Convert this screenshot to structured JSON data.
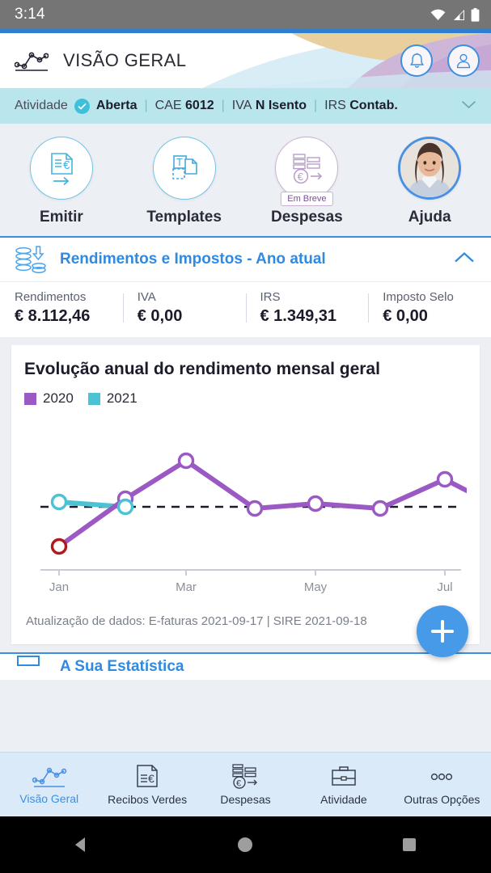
{
  "statusbar": {
    "time": "3:14",
    "icons": [
      "wifi-icon",
      "signal-icon",
      "battery-icon"
    ]
  },
  "header": {
    "title": "VISÃO GERAL",
    "logo_icon": "line-chart-logo-icon",
    "notifications_icon": "bell-icon",
    "profile_icon": "user-icon",
    "accent_color": "#2f7fd0"
  },
  "activity_bar": {
    "label": "Atividade",
    "status": "Aberta",
    "check_icon": "check-circle-icon",
    "fields": [
      {
        "key": "CAE",
        "value": "6012"
      },
      {
        "key": "IVA",
        "value": "N Isento"
      },
      {
        "key": "IRS",
        "value": "Contab."
      }
    ],
    "expand_icon": "chevron-down-icon",
    "background_color": "#b8e6ec"
  },
  "quick_actions": [
    {
      "label": "Emitir",
      "icon": "invoice-euro-arrow-icon",
      "badge": "",
      "disabled": false
    },
    {
      "label": "Templates",
      "icon": "template-document-icon",
      "badge": "",
      "disabled": false
    },
    {
      "label": "Despesas",
      "icon": "expenses-euro-arrow-icon",
      "badge": "Em Breve",
      "disabled": true
    },
    {
      "label": "Ajuda",
      "icon": "support-agent-photo",
      "badge": "",
      "disabled": false
    }
  ],
  "income_section": {
    "icon": "coins-download-icon",
    "title": "Rendimentos e Impostos - Ano atual",
    "collapse_icon": "chevron-up-icon",
    "title_color": "#2f8ae0",
    "stats": [
      {
        "key": "Rendimentos",
        "value": "€ 8.112,46"
      },
      {
        "key": "IVA",
        "value": "€ 0,00"
      },
      {
        "key": "IRS",
        "value": "€ 1.349,31"
      },
      {
        "key": "Imposto Selo",
        "value": "€ 0,00"
      }
    ]
  },
  "chart_card": {
    "footer": "Atualização de dados: E-faturas 2021-09-17 | SIRE 2021-09-18",
    "fab_icon": "add-plus-icon",
    "fab_color": "#479ae8"
  },
  "chart_data": {
    "type": "line",
    "title": "Evolução anual do rendimento mensal geral",
    "xlabel": "",
    "ylabel": "",
    "grid": false,
    "legend_position": "top-left",
    "x": [
      "Jan",
      "Feb",
      "Mar",
      "Apr",
      "May",
      "Jun",
      "Jul",
      "Aug"
    ],
    "tick_labels": [
      "Jan",
      "Mar",
      "May",
      "Jul"
    ],
    "ylim": [
      0,
      100
    ],
    "average_line": {
      "value": 55,
      "style": "dashed",
      "color": "#1b1b2a"
    },
    "series": [
      {
        "name": "2020",
        "color": "#9B59C4",
        "values": [
          16,
          58,
          92,
          55,
          57,
          55,
          73,
          68
        ],
        "markers": [
          {
            "x": "Jan",
            "y": 16,
            "color": "#b01a1a",
            "highlight": true
          },
          {
            "x": "Feb",
            "y": 58,
            "color": "#9B59C4",
            "highlight": false
          },
          {
            "x": "Mar",
            "y": 92,
            "color": "#9B59C4",
            "highlight": false
          },
          {
            "x": "Apr",
            "y": 55,
            "color": "#9B59C4",
            "highlight": false
          },
          {
            "x": "May",
            "y": 57,
            "color": "#9B59C4",
            "highlight": false
          },
          {
            "x": "Jun",
            "y": 55,
            "color": "#9B59C4",
            "highlight": false
          },
          {
            "x": "Jul",
            "y": 73,
            "color": "#9B59C4",
            "highlight": false
          }
        ]
      },
      {
        "name": "2021",
        "color": "#4BC3D4",
        "values": [
          57,
          55
        ],
        "markers": [
          {
            "x": "Jan",
            "y": 57,
            "color": "#4BC3D4",
            "highlight": false
          },
          {
            "x": "Feb",
            "y": 55,
            "color": "#4BC3D4",
            "highlight": false
          }
        ]
      }
    ],
    "legend": [
      {
        "label": "2020",
        "color": "#9B59C4"
      },
      {
        "label": "2021",
        "color": "#4BC3D4"
      }
    ]
  },
  "next_section": {
    "title": "A Sua Estatística",
    "icon": "statistics-icon"
  },
  "bottom_nav": [
    {
      "label": "Visão Geral",
      "icon": "line-chart-icon",
      "active": true
    },
    {
      "label": "Recibos Verdes",
      "icon": "receipt-euro-icon",
      "active": false
    },
    {
      "label": "Despesas",
      "icon": "expenses-euro-icon",
      "active": false
    },
    {
      "label": "Atividade",
      "icon": "briefcase-icon",
      "active": false
    },
    {
      "label": "Outras Opções",
      "icon": "more-dots-icon",
      "active": false
    }
  ],
  "android_nav": [
    {
      "name": "back",
      "icon": "triangle-back-icon"
    },
    {
      "name": "home",
      "icon": "circle-home-icon"
    },
    {
      "name": "recents",
      "icon": "square-recents-icon"
    }
  ]
}
